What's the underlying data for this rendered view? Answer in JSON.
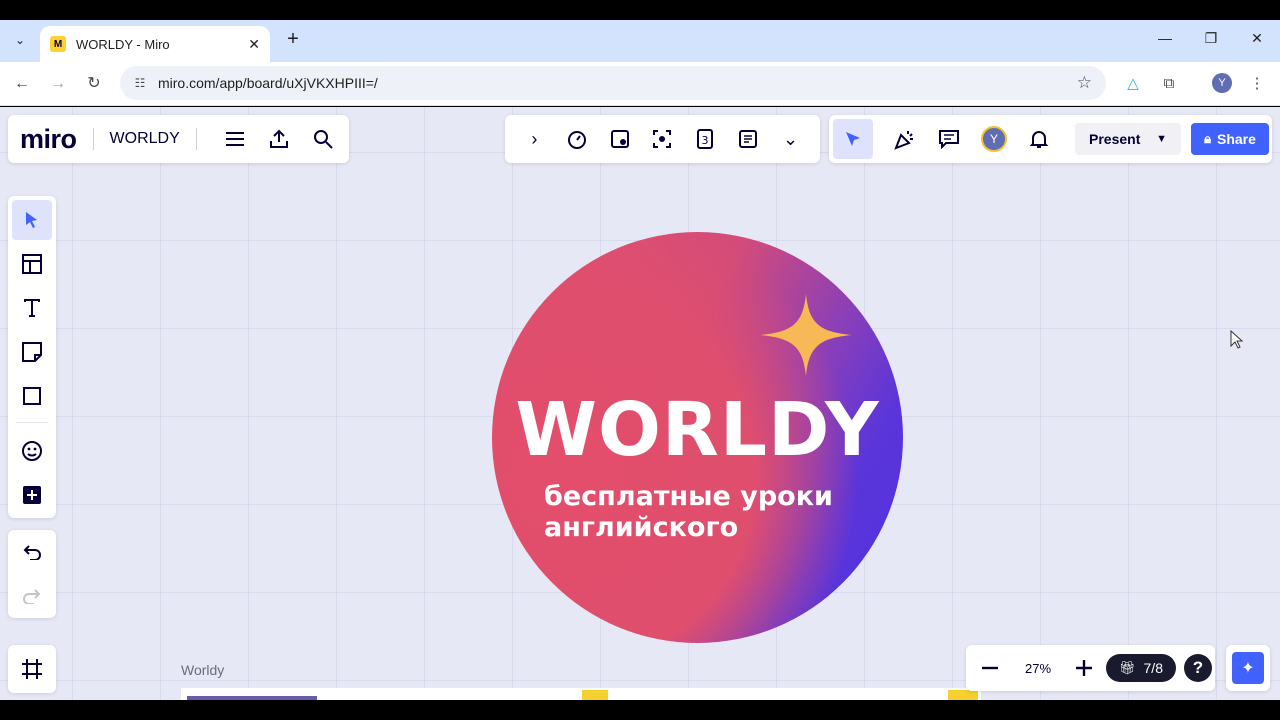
{
  "browser": {
    "tab_title": "WORLDY - Miro",
    "favicon_letter": "M",
    "url": "miro.com/app/board/uXjVKXHPIII=/",
    "profile_initial": "Y"
  },
  "board": {
    "logo": "miro",
    "name": "WORLDY",
    "frame_label": "Worldy"
  },
  "logo_art": {
    "title": "WORLDY",
    "subtitle_line1": "бесплатные уроки",
    "subtitle_line2": "английского"
  },
  "collab": {
    "avatar_initial": "Y",
    "present_label": "Present",
    "share_label": "Share"
  },
  "zoom": {
    "value": "27%",
    "gift_count": "7/8",
    "help_label": "?"
  },
  "icons": {
    "left_tools": [
      "select-icon",
      "templates-icon",
      "text-icon",
      "sticky-note-icon",
      "shape-icon",
      "stickers-icon",
      "add-icon"
    ],
    "undo": [
      "undo-icon",
      "redo-icon"
    ]
  },
  "colors": {
    "accent": "#4262ff",
    "canvas": "#e7e8f5",
    "sparkle": "#f7b955",
    "logo_red": "#e24e6b",
    "logo_purple": "#5030e0"
  }
}
